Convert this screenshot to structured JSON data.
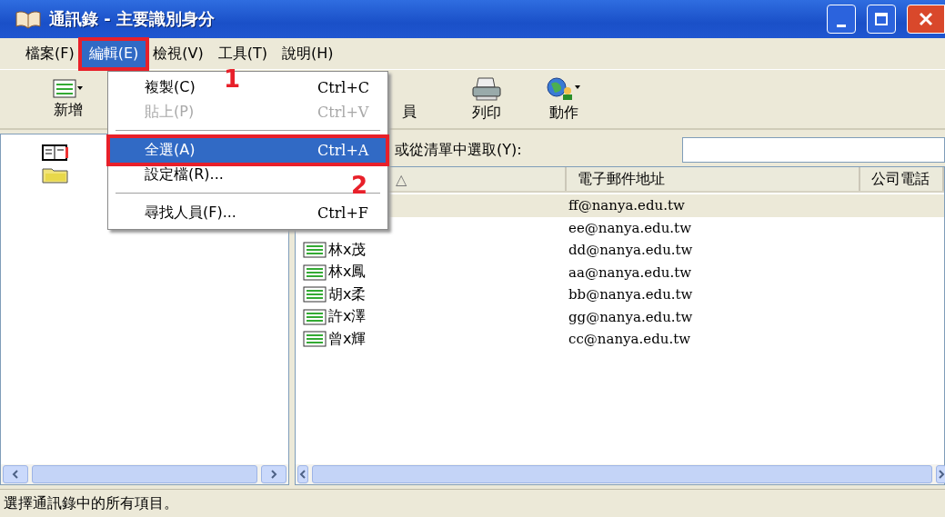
{
  "window": {
    "title": "通訊錄 - 主要識別身分"
  },
  "menu_bar": [
    {
      "label": "檔案(F)",
      "selected": false
    },
    {
      "label": "編輯(E)",
      "selected": true
    },
    {
      "label": "檢視(V)",
      "selected": false
    },
    {
      "label": "工具(T)",
      "selected": false
    },
    {
      "label": "說明(H)",
      "selected": false
    }
  ],
  "toolbar": [
    {
      "label": "新增",
      "kind": "new"
    },
    {
      "label": "員",
      "kind": "partial"
    },
    {
      "label": "列印",
      "kind": "print"
    },
    {
      "label": "動作",
      "kind": "action"
    }
  ],
  "tree": [
    {
      "kind": "book"
    },
    {
      "kind": "folder"
    }
  ],
  "search": {
    "label": "或從清單中選取(Y):"
  },
  "table": {
    "columns": [
      "△",
      "電子郵件地址",
      "公司電話"
    ],
    "rows": [
      {
        "email": "ff@nanya.edu.tw",
        "selected": true
      },
      {
        "email": "ee@nanya.edu.tw",
        "selected": false
      },
      {
        "name": "林x茂",
        "email": "dd@nanya.edu.tw",
        "selected": false
      },
      {
        "name": "林x鳳",
        "email": "aa@nanya.edu.tw",
        "selected": false
      },
      {
        "name": "胡x柔",
        "email": "bb@nanya.edu.tw",
        "selected": false
      },
      {
        "name": "許x澤",
        "email": "gg@nanya.edu.tw",
        "selected": false
      },
      {
        "name": "曾x輝",
        "email": "cc@nanya.edu.tw",
        "selected": false
      }
    ]
  },
  "edit_menu": [
    {
      "kind": "item",
      "label": "複製(C)",
      "shortcut": "Ctrl+C",
      "disabled": false,
      "selected": false
    },
    {
      "kind": "item",
      "label": "貼上(P)",
      "shortcut": "Ctrl+V",
      "disabled": true,
      "selected": false
    },
    {
      "kind": "separator"
    },
    {
      "kind": "item",
      "label": "全選(A)",
      "shortcut": "Ctrl+A",
      "disabled": false,
      "selected": true
    },
    {
      "kind": "item",
      "label": "設定檔(R)...",
      "disabled": false,
      "selected": false
    },
    {
      "kind": "separator"
    },
    {
      "kind": "item",
      "label": "尋找人員(F)...",
      "shortcut": "Ctrl+F",
      "disabled": false,
      "selected": false
    }
  ],
  "annotations": [
    "1",
    "2"
  ],
  "status_bar": "選擇通訊錄中的所有項目。"
}
